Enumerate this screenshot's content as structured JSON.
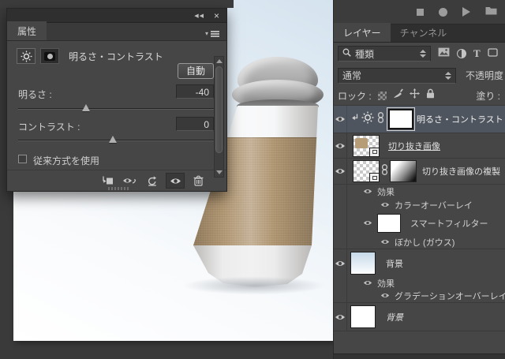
{
  "properties_panel": {
    "tab_title": "属性",
    "collapse_glyph": "◀◀",
    "close_glyph": "×",
    "menu_caret_glyph": "▾",
    "adjustment_title": "明るさ・コントラスト",
    "auto_button_label": "自動",
    "brightness_label": "明るさ :",
    "brightness_value": "-40",
    "contrast_label": "コントラスト :",
    "contrast_value": "0",
    "legacy_checkbox_label": "従来方式を使用",
    "legacy_checkbox_checked": false
  },
  "layers_panel": {
    "tab_layers": "レイヤー",
    "tab_channels": "チャンネル",
    "filter_kind_label": "種類",
    "text_tool_glyph": "T",
    "blend_mode_value": "通常",
    "opacity_label": "不透明度 :",
    "lock_label": "ロック :",
    "fill_label": "塗り :",
    "rows": {
      "adjustment_layer": "明るさ・コントラスト",
      "cutout_layer": "切り抜き画像",
      "cutout_copy_layer": "切り抜き画像の複製",
      "effects1": "効果",
      "color_overlay": "カラーオーバーレイ",
      "smart_filters": "スマートフィルター",
      "gaussian_blur": "ぼかし (ガウス)",
      "background_layer1": "背景",
      "effects2": "効果",
      "gradient_overlay": "グラデーションオーバーレイ",
      "background_layer2": "背景"
    },
    "selected_row": "adjustment_layer"
  },
  "colors": {
    "panel_bg": "#464646",
    "selected_row_bg": "#4e555e",
    "pasteboard": "#3a3a3a",
    "canvas_top": "#d5e3ef",
    "canvas_bottom": "#ffffff",
    "sleeve_kraft": "#b49a76"
  }
}
